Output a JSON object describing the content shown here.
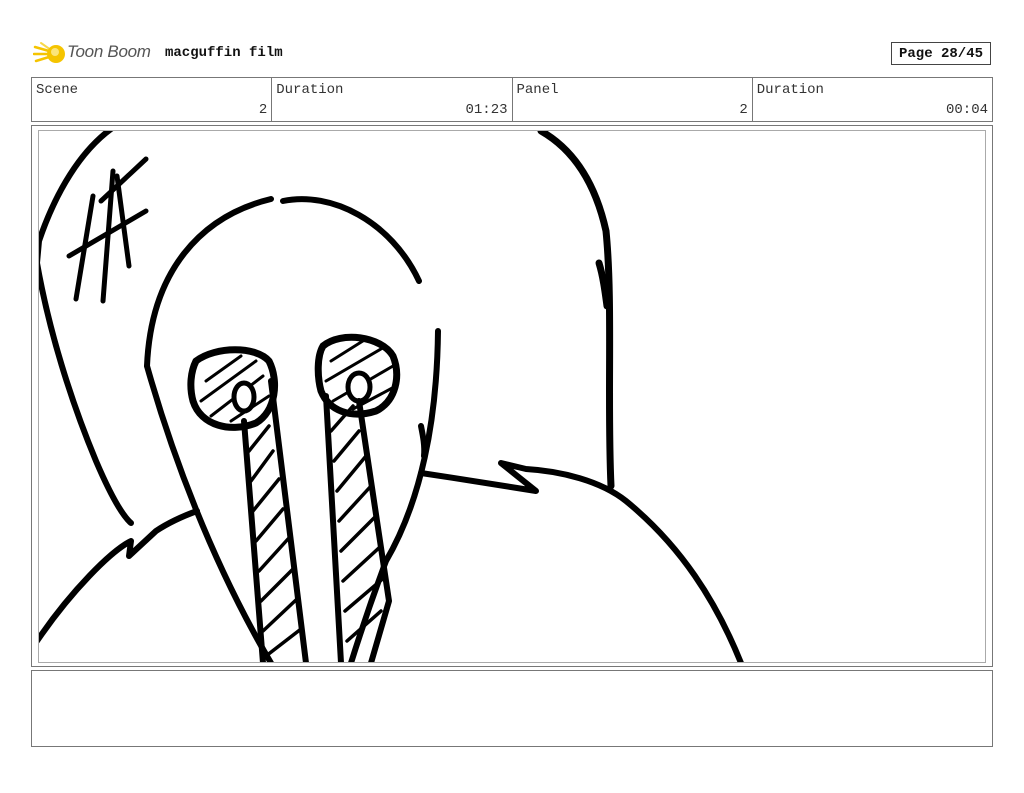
{
  "header": {
    "brand": "Toon Boom",
    "project_title": "macguffin film",
    "page_label": "Page 28/45"
  },
  "info": {
    "scene_label": "Scene",
    "scene_value": "2",
    "scene_duration_label": "Duration",
    "scene_duration_value": "01:23",
    "panel_label": "Panel",
    "panel_value": "2",
    "panel_duration_label": "Duration",
    "panel_duration_value": "00:04"
  },
  "panel": {
    "sketch": "character-sketch"
  },
  "notes": {
    "text": ""
  }
}
